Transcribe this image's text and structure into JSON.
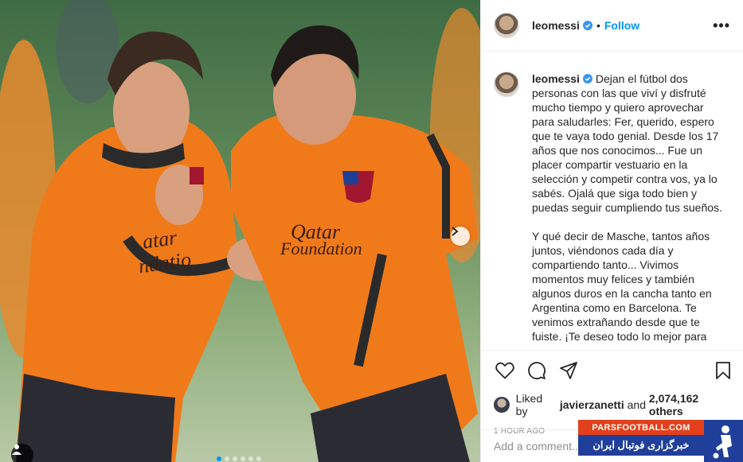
{
  "post": {
    "username": "leomessi",
    "follow_label": "Follow",
    "separator": "•",
    "more_label": "•••"
  },
  "photo": {
    "sponsor_line1": "Qatar",
    "sponsor_line2": "Foundation",
    "sponsor_left_line1": "atar",
    "sponsor_left_line2": "ndatio",
    "carousel_count": 6,
    "carousel_active_index": 0
  },
  "caption": {
    "username": "leomessi",
    "paragraph1": "Dejan el fútbol dos personas con las que viví y disfruté mucho tiempo y quiero aprovechar para saludarles: Fer, querido, espero que te vaya todo genial. Desde los 17 años que nos conocimos... Fue un placer compartir vestuario en la selección y competir contra vos, ya lo sabés. Ojalá que siga todo bien y puedas seguir cumpliendo tus sueños.",
    "paragraph2": "Y qué decir de Masche, tantos años juntos, viéndonos cada día y compartiendo tanto... Vivimos momentos muy felices y también algunos duros en la cancha tanto en Argentina como en Barcelona. Te venimos extrañando desde que te fuiste. ¡Te deseo todo lo mejor para"
  },
  "likes": {
    "prefix": "Liked by",
    "user": "javierzanetti",
    "and": "and",
    "count": "2,074,162 others"
  },
  "timestamp": "1 HOUR AGO",
  "comment": {
    "placeholder": "Add a comment..."
  },
  "watermark": {
    "site": "PARSFOOTBALL.COM",
    "tagline": "خبرگزاری فوتبال ایران"
  },
  "colors": {
    "accent": "#0095f6",
    "jersey_orange": "#f07a1a",
    "watermark_red": "#e2401c",
    "watermark_blue": "#1f3f9a"
  },
  "icons": [
    "verified-badge-icon",
    "more-options-icon",
    "heart-icon",
    "comment-icon",
    "share-icon",
    "bookmark-icon",
    "chevron-right-icon",
    "user-tag-icon"
  ]
}
